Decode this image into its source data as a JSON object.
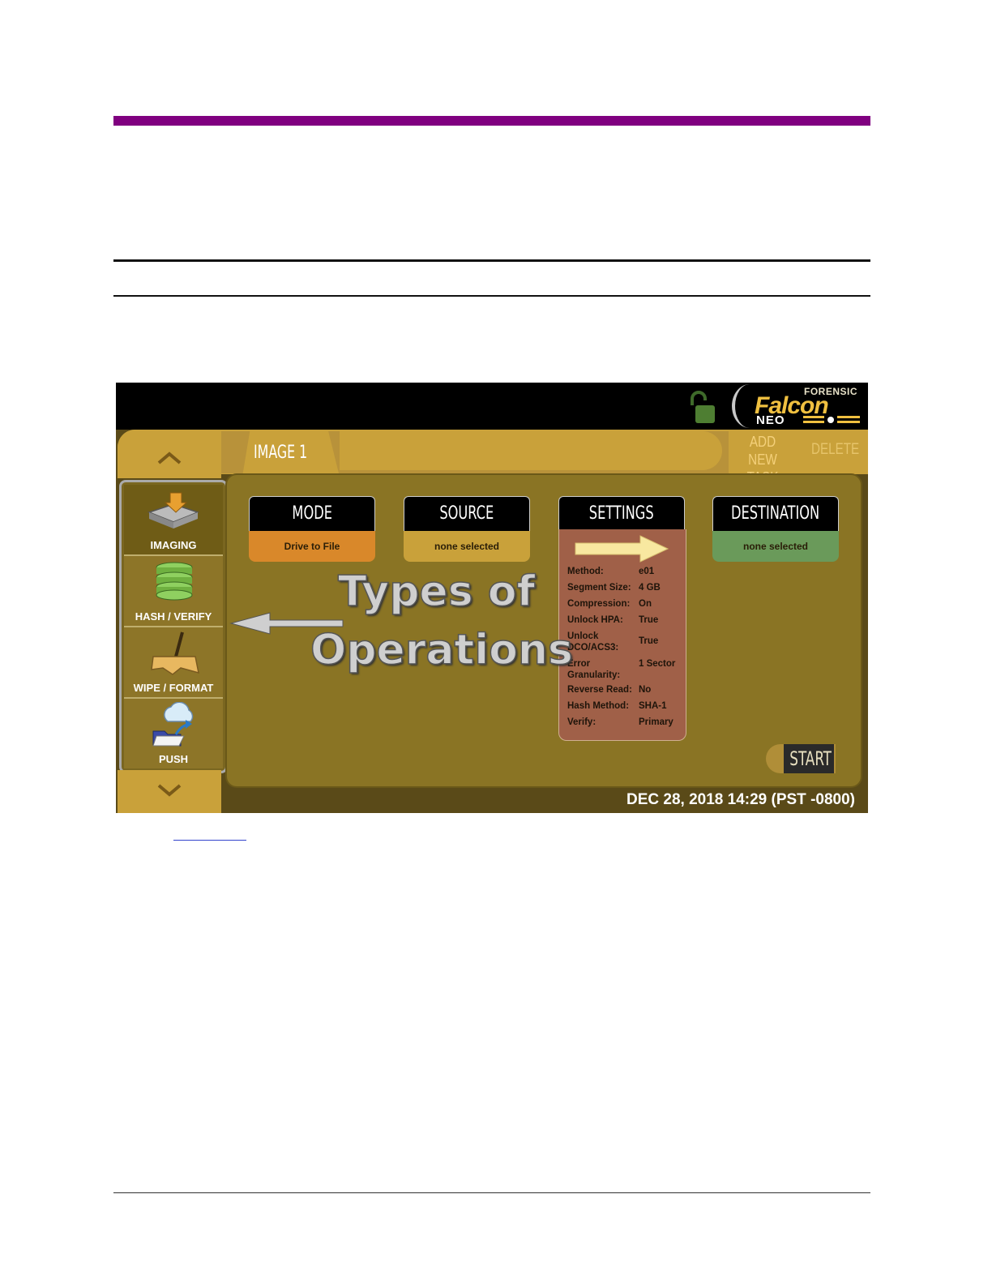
{
  "screen": {
    "logo": {
      "forensic": "FORENSIC",
      "falcon": "Falcon",
      "neo": "NEO"
    },
    "tab": {
      "active_label": "IMAGE 1"
    },
    "header_actions": {
      "add_new_line1": "ADD NEW",
      "add_new_line2": "TASK",
      "delete": "DELETE"
    },
    "operations": [
      {
        "label": "IMAGING",
        "icon": "imaging-icon"
      },
      {
        "label": "HASH / VERIFY",
        "icon": "hash-stack-icon"
      },
      {
        "label": "WIPE / FORMAT",
        "icon": "broom-icon"
      },
      {
        "label": "PUSH",
        "icon": "cloud-push-icon"
      }
    ],
    "cards": {
      "mode": {
        "title": "MODE",
        "value": "Drive to File"
      },
      "source": {
        "title": "SOURCE",
        "value": "none selected"
      },
      "settings": {
        "title": "SETTINGS"
      },
      "destination": {
        "title": "DESTINATION",
        "value": "none selected"
      }
    },
    "settings_rows": [
      {
        "label": "Method:",
        "value": "e01"
      },
      {
        "label": "Segment Size:",
        "value": "4 GB"
      },
      {
        "label": "Compression:",
        "value": "On"
      },
      {
        "label": "Unlock HPA:",
        "value": "True"
      },
      {
        "label": "Unlock DCO/ACS3:",
        "value": "True"
      },
      {
        "label": "Error Granularity:",
        "value": "1 Sector"
      },
      {
        "label": "Reverse Read:",
        "value": "No"
      },
      {
        "label": "Hash Method:",
        "value": "SHA-1"
      },
      {
        "label": "Verify:",
        "value": "Primary"
      }
    ],
    "overlay": {
      "line1": "Types of",
      "line2": "Operations"
    },
    "start": "START",
    "datetime": "DEC 28, 2018 14:29 (PST -0800)"
  },
  "colors": {
    "accent_purple": "#800080",
    "mode_orange": "#d9882a",
    "source_gold": "#c9a13a",
    "settings_red": "#a06048",
    "destination_green": "#6a9a5a"
  }
}
